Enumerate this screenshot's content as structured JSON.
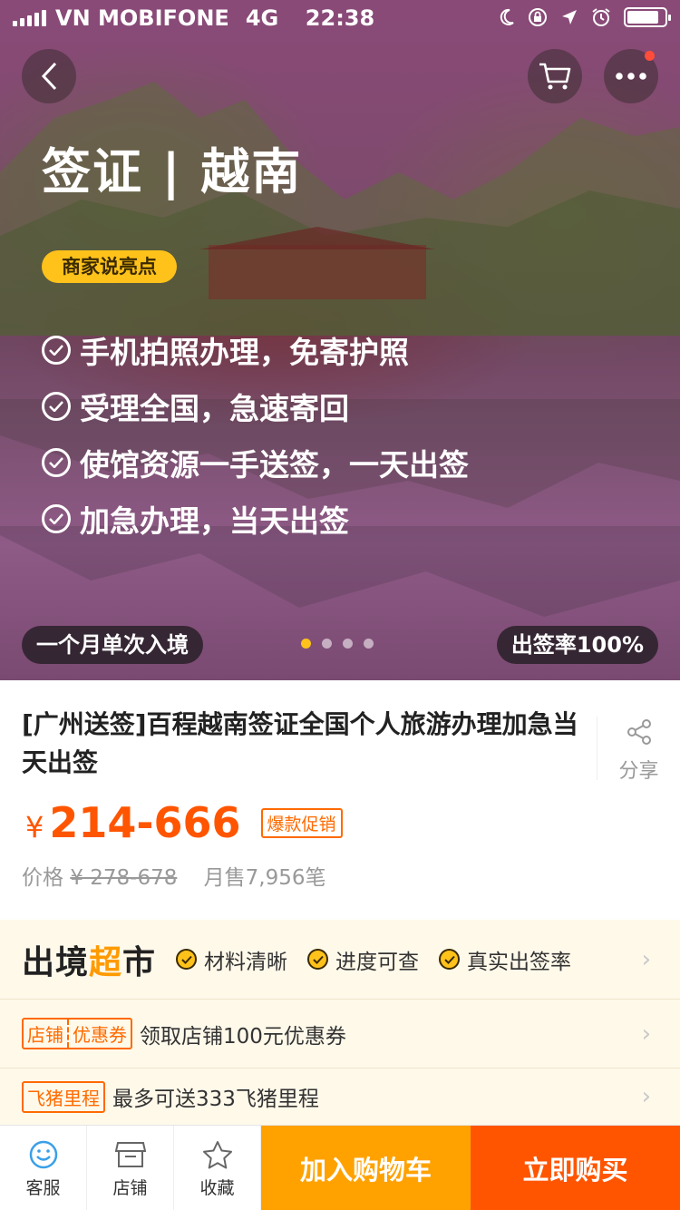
{
  "status_bar": {
    "carrier": "VN MOBIFONE",
    "network": "4G",
    "time": "22:38"
  },
  "hero": {
    "title": "签证 | 越南",
    "highlight_badge": "商家说亮点",
    "features": [
      "手机拍照办理，免寄护照",
      "受理全国，急速寄回",
      "使馆资源一手送签，一天出签",
      "加急办理，当天出签"
    ],
    "entry_type": "一个月单次入境",
    "success_rate": "出签率100%",
    "carousel": {
      "count": 4,
      "active_index": 0
    }
  },
  "product": {
    "title": "[广州送签]百程越南签证全国个人旅游办理加急当天出签",
    "share_label": "分享",
    "currency": "¥",
    "price": "214-666",
    "promo_tag": "爆款促销",
    "original_price_label": "价格",
    "original_price": "¥ 278-678",
    "monthly_sales": "月售7,956笔"
  },
  "service": {
    "brand_name_a": "出境",
    "brand_name_b": "超",
    "brand_name_c": "市",
    "guarantees": [
      "材料清晰",
      "进度可查",
      "真实出签率"
    ],
    "coupon": {
      "tag_a": "店铺",
      "tag_b": "优惠券",
      "text": "领取店铺100元优惠券"
    },
    "miles": {
      "tag": "飞猪里程",
      "text": "最多可送333飞猪里程"
    }
  },
  "bottom_bar": {
    "service_label": "客服",
    "shop_label": "店铺",
    "favorite_label": "收藏",
    "add_to_cart_label": "加入购物车",
    "buy_now_label": "立即购买"
  },
  "colors": {
    "accent_orange": "#ff5500",
    "cart_orange": "#ffa200",
    "badge_yellow": "#ffc21a"
  }
}
